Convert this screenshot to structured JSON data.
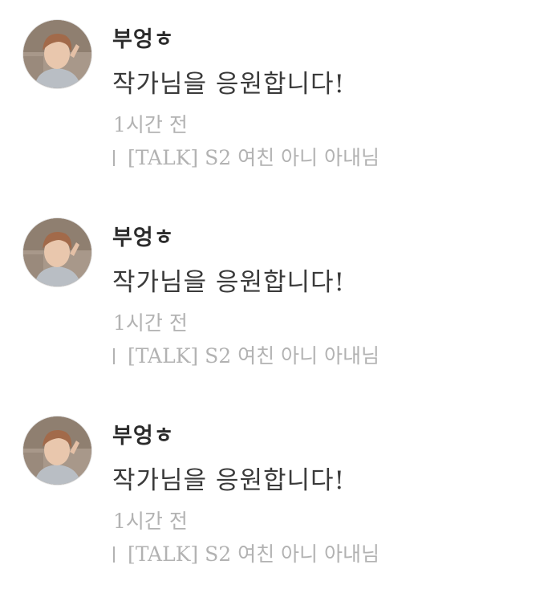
{
  "comments": [
    {
      "author": "부엉ㅎ",
      "message": "작가님을 응원합니다!",
      "time": "1시간 전",
      "post_title": "[TALK] S2 여친 아니 아내님",
      "avatar_icon": "user-avatar-photo"
    },
    {
      "author": "부엉ㅎ",
      "message": "작가님을 응원합니다!",
      "time": "1시간 전",
      "post_title": "[TALK] S2 여친 아니 아내님",
      "avatar_icon": "user-avatar-photo"
    },
    {
      "author": "부엉ㅎ",
      "message": "작가님을 응원합니다!",
      "time": "1시간 전",
      "post_title": "[TALK] S2 여친 아니 아내님",
      "avatar_icon": "user-avatar-photo"
    }
  ],
  "colors": {
    "author": "#2b2b2b",
    "message": "#3a3a3a",
    "meta": "#b2b2b2",
    "background": "#ffffff"
  }
}
